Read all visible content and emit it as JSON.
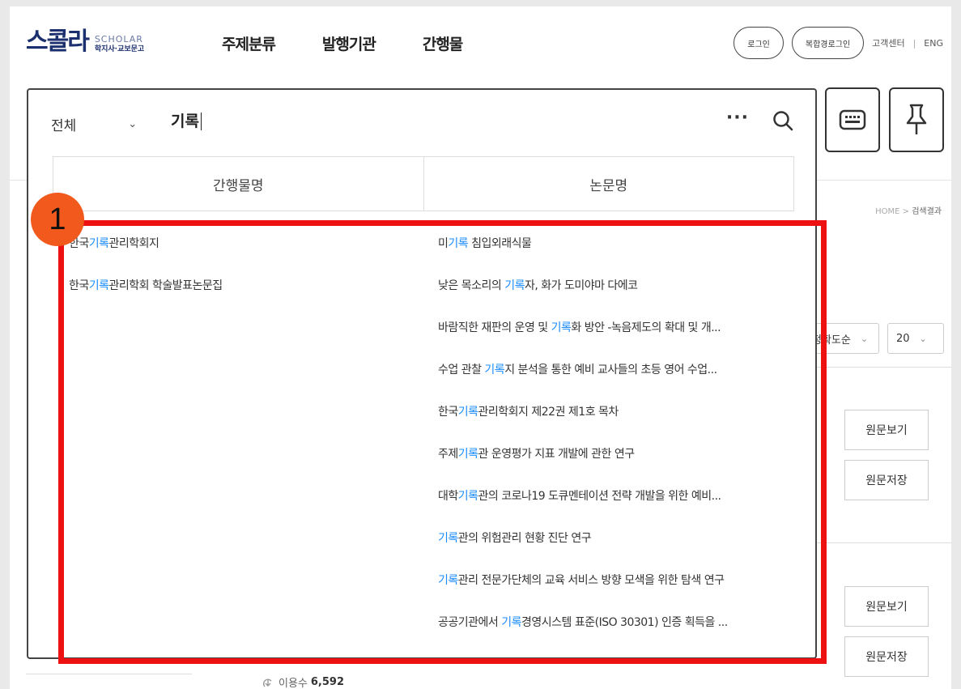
{
  "header": {
    "logo_main": "스콜라",
    "logo_en": "SCHOLAR",
    "logo_ko": "학지사·교보문고",
    "nav": [
      "주제분류",
      "발행기관",
      "간행물"
    ],
    "login": "로그인",
    "group_login": "복합경로그인",
    "support": "고객센터",
    "separator": "|",
    "lang": "ENG"
  },
  "search": {
    "scope": "전체",
    "query": "기록",
    "more": "···",
    "tabs": [
      "간행물명",
      "논문명"
    ]
  },
  "suggestions": {
    "journals": [
      {
        "pre": "한국",
        "hl": "기록",
        "post": "관리학회지"
      },
      {
        "pre": "한국",
        "hl": "기록",
        "post": "관리학회 학술발표논문집"
      }
    ],
    "papers": [
      {
        "pre": "미",
        "hl": "기록",
        "post": " 침입외래식물"
      },
      {
        "pre": "낮은 목소리의 ",
        "hl": "기록",
        "post": "자, 화가 도미야마 다에코"
      },
      {
        "pre": "바람직한 재판의 운영 및 ",
        "hl": "기록",
        "post": "화 방안 -녹음제도의 확대 및 개..."
      },
      {
        "pre": "수업 관찰 ",
        "hl": "기록",
        "post": "지 분석을 통한 예비 교사들의 초등 영어 수업..."
      },
      {
        "pre": "한국",
        "hl": "기록",
        "post": "관리학회지 제22권 제1호 목차"
      },
      {
        "pre": "주제",
        "hl": "기록",
        "post": "관 운영평가 지표 개발에 관한 연구"
      },
      {
        "pre": "대학",
        "hl": "기록",
        "post": "관의 코로나19 도큐멘테이션 전략 개발을 위한 예비..."
      },
      {
        "pre": "",
        "hl": "기록",
        "post": "관의 위험관리 현황 진단 연구"
      },
      {
        "pre": "",
        "hl": "기록",
        "post": "관리 전문가단체의 교육 서비스 방향 모색을 위한 탐색 연구"
      },
      {
        "pre": "공공기관에서 ",
        "hl": "기록",
        "post": "경영시스템 표준(ISO 30301) 인증 획득을 ..."
      }
    ]
  },
  "background": {
    "breadcrumb_home": "HOME",
    "breadcrumb_arrow": ">",
    "breadcrumb_current": "검색결과",
    "sort": "정확도순",
    "per_page": "20",
    "view_original": "원문보기",
    "save_original": "원문저장",
    "views_label": "이용수",
    "views_value": "6,592"
  },
  "annotation": {
    "badge": "1",
    "color": "#ee1111",
    "badge_color": "#f2591c"
  },
  "colors": {
    "highlight": "#1a8cff",
    "logo": "#1c2f6e"
  }
}
